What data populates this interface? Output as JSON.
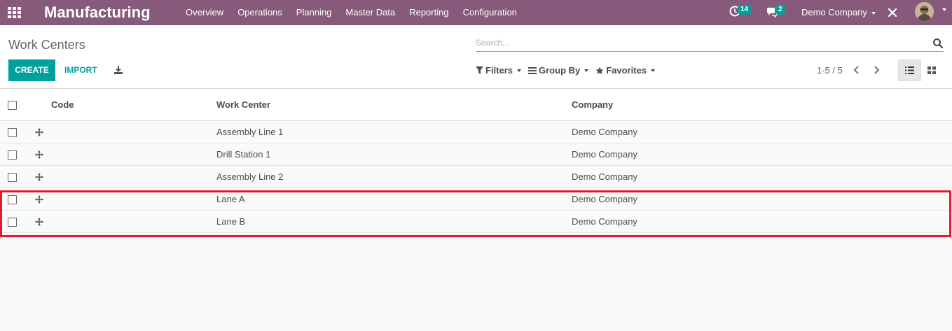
{
  "app": {
    "brand": "Manufacturing",
    "menu": [
      "Overview",
      "Operations",
      "Planning",
      "Master Data",
      "Reporting",
      "Configuration"
    ],
    "activity_count": "14",
    "messages_count": "2",
    "company": "Demo Company",
    "colors": {
      "navbar": "#875a7b",
      "accent": "#00a09d",
      "highlight": "#e31b2a"
    }
  },
  "control_panel": {
    "title": "Work Centers",
    "search_placeholder": "Search...",
    "create_label": "CREATE",
    "import_label": "IMPORT",
    "filters_label": "Filters",
    "group_by_label": "Group By",
    "favorites_label": "Favorites",
    "pager": "1-5 / 5"
  },
  "table": {
    "headers": {
      "code": "Code",
      "work_center": "Work Center",
      "company": "Company"
    },
    "rows": [
      {
        "code": "",
        "work_center": "Assembly Line 1",
        "company": "Demo Company"
      },
      {
        "code": "",
        "work_center": "Drill Station 1",
        "company": "Demo Company"
      },
      {
        "code": "",
        "work_center": "Assembly Line 2",
        "company": "Demo Company"
      },
      {
        "code": "",
        "work_center": "Lane A",
        "company": "Demo Company"
      },
      {
        "code": "",
        "work_center": "Lane B",
        "company": "Demo Company"
      }
    ]
  }
}
